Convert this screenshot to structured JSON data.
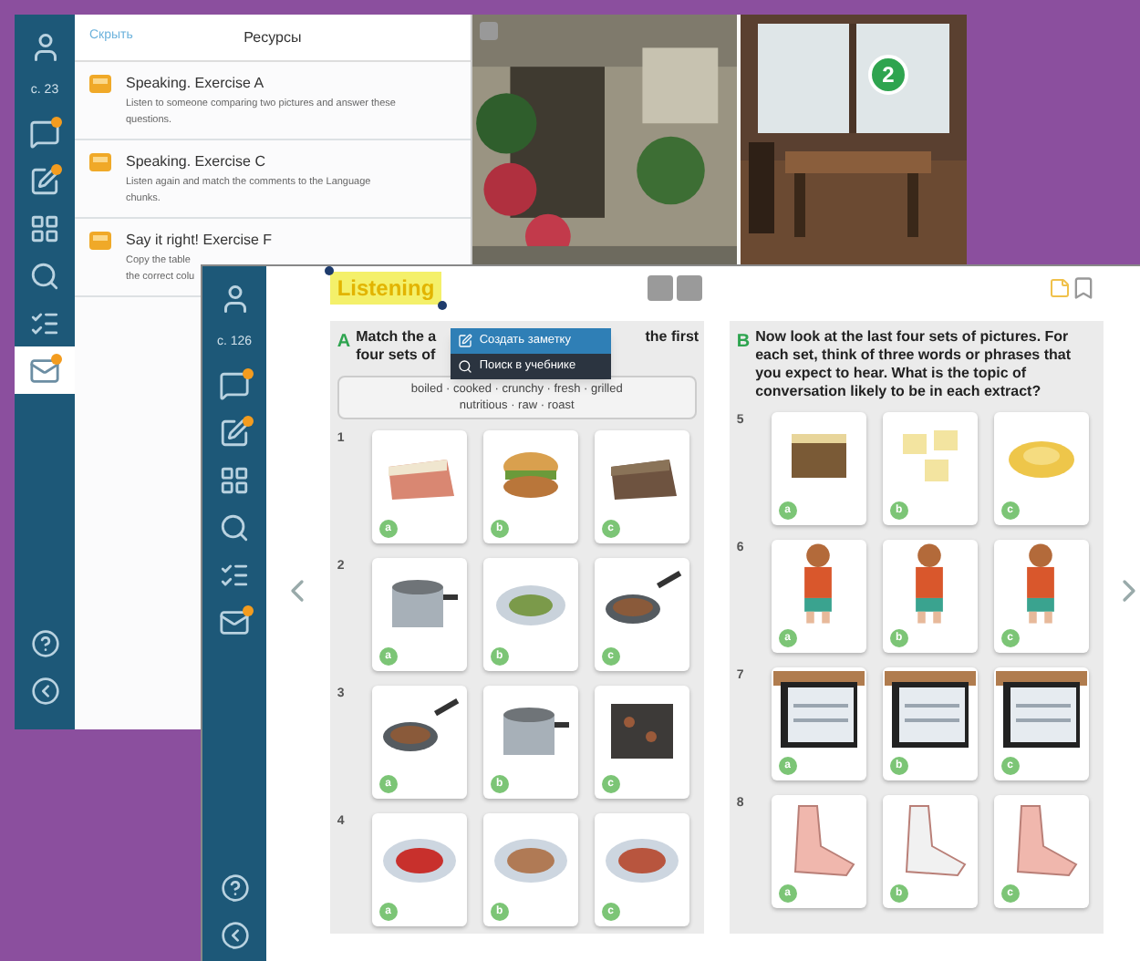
{
  "back_screen": {
    "sidebar": {
      "page": "с. 23",
      "tools": [
        {
          "kind": "chat",
          "notification": true,
          "selected": false
        },
        {
          "kind": "edit",
          "notification": true,
          "selected": false
        },
        {
          "kind": "grid",
          "notification": false,
          "selected": false
        },
        {
          "kind": "search",
          "notification": false,
          "selected": false
        },
        {
          "kind": "list",
          "notification": false,
          "selected": false
        },
        {
          "kind": "resources",
          "notification": true,
          "selected": true
        }
      ],
      "bottom": [
        {
          "kind": "help"
        },
        {
          "kind": "back"
        }
      ]
    },
    "resources_panel": {
      "hide_link": "Скрыть",
      "title": "Ресурсы",
      "items": [
        {
          "title": "Speaking. Exercise A",
          "description_lines": [
            "Listen to someone comparing two pictures and answer these",
            "questions."
          ]
        },
        {
          "title": "Speaking. Exercise C",
          "description_lines": [
            "Listen again and match the comments to the Language",
            "chunks."
          ]
        },
        {
          "title": "Say it right! Exercise F",
          "description_lines": [
            "Copy the table",
            "the correct colu"
          ]
        }
      ]
    },
    "photo_badge": "2"
  },
  "front_screen": {
    "sidebar": {
      "page": "с. 126",
      "tools": [
        {
          "kind": "chat",
          "notification": true,
          "selected": false
        },
        {
          "kind": "edit",
          "notification": true,
          "selected": false
        },
        {
          "kind": "grid",
          "notification": false,
          "selected": false
        },
        {
          "kind": "search",
          "notification": false,
          "selected": false
        },
        {
          "kind": "list",
          "notification": false,
          "selected": false
        },
        {
          "kind": "resources",
          "notification": true,
          "selected": false
        }
      ],
      "bottom": [
        {
          "kind": "help"
        },
        {
          "kind": "back"
        }
      ]
    },
    "heading": "Listening",
    "context_menu": [
      {
        "kind": "note",
        "label": "Создать заметку",
        "selected": true
      },
      {
        "kind": "search",
        "label": "Поиск в учебнике",
        "selected": false
      }
    ],
    "sections": [
      {
        "letter": "A",
        "instruction_parts": [
          "Match the a",
          "the first",
          "four sets of"
        ],
        "word_box": [
          "boiled · cooked · crunchy · fresh · grilled",
          "nutritious · raw · roast"
        ],
        "rows": [
          {
            "number": "1",
            "cards": [
              "a",
              "b",
              "c"
            ]
          },
          {
            "number": "2",
            "cards": [
              "a",
              "b",
              "c"
            ]
          },
          {
            "number": "3",
            "cards": [
              "a",
              "b",
              "c"
            ]
          },
          {
            "number": "4",
            "cards": [
              "a",
              "b",
              "c"
            ]
          }
        ]
      },
      {
        "letter": "B",
        "instruction": "Now look at the last four sets of pictures. For each set, think of three words or phrases that you expect to hear. What is the topic of conversation likely to be in each extract?",
        "rows": [
          {
            "number": "5",
            "cards": [
              "a",
              "b",
              "c"
            ]
          },
          {
            "number": "6",
            "cards": [
              "a",
              "b",
              "c"
            ]
          },
          {
            "number": "7",
            "cards": [
              "a",
              "b",
              "c"
            ]
          },
          {
            "number": "8",
            "cards": [
              "a",
              "b",
              "c"
            ]
          }
        ]
      }
    ]
  }
}
